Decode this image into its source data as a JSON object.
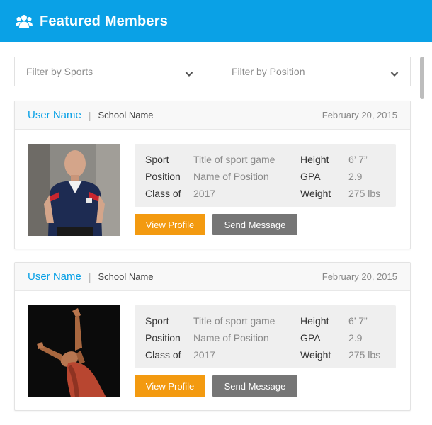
{
  "header": {
    "title": "Featured Members",
    "icon": "users-icon"
  },
  "filters": {
    "sports": {
      "placeholder": "Filter by Sports"
    },
    "position": {
      "placeholder": "Filter by Position"
    }
  },
  "colors": {
    "accent": "#0aa1e6",
    "view_button": "#f39a10",
    "message_button": "#767676"
  },
  "members": [
    {
      "user_name": "User Name",
      "separator": "|",
      "school": "School Name",
      "date": "February 20, 2015",
      "fields": {
        "sport_label": "Sport",
        "sport": "Title of sport game",
        "position_label": "Position",
        "position": "Name of Position",
        "class_label": "Class of",
        "class": "2017",
        "height_label": "Height",
        "height": "6’ 7”",
        "gpa_label": "GPA",
        "gpa": "2.9",
        "weight_label": "Weight",
        "weight": "275 lbs"
      },
      "view_label": "View Profile",
      "message_label": "Send Message"
    },
    {
      "user_name": "User Name",
      "separator": "|",
      "school": "School Name",
      "date": "February 20, 2015",
      "fields": {
        "sport_label": "Sport",
        "sport": "Title of sport game",
        "position_label": "Position",
        "position": "Name of Position",
        "class_label": "Class of",
        "class": "2017",
        "height_label": "Height",
        "height": "6’ 7”",
        "gpa_label": "GPA",
        "gpa": "2.9",
        "weight_label": "Weight",
        "weight": "275 lbs"
      },
      "view_label": "View Profile",
      "message_label": "Send Message"
    }
  ]
}
